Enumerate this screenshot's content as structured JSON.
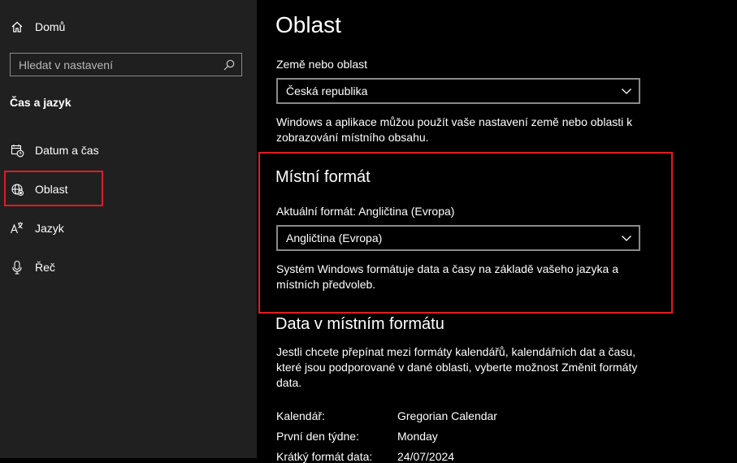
{
  "sidebar": {
    "home_label": "Domů",
    "search_placeholder": "Hledat v nastavení",
    "section_title": "Čas a jazyk",
    "items": [
      {
        "label": "Datum a čas",
        "icon": "calendar-clock-icon"
      },
      {
        "label": "Oblast",
        "icon": "globe-region-icon"
      },
      {
        "label": "Jazyk",
        "icon": "language-icon"
      },
      {
        "label": "Řeč",
        "icon": "microphone-icon"
      }
    ]
  },
  "main": {
    "title": "Oblast",
    "country": {
      "label": "Země nebo oblast",
      "value": "Česká republika",
      "description": "Windows a aplikace můžou použít vaše nastavení země nebo oblasti k zobrazování místního obsahu."
    },
    "regional_format": {
      "heading": "Místní formát",
      "current": "Aktuální formát: Angličtina (Evropa)",
      "value": "Angličtina (Evropa)",
      "description": "Systém Windows formátuje data a časy na základě vašeho jazyka a místních předvoleb."
    },
    "format_data": {
      "heading": "Data v místním formátu",
      "description": "Jestli chcete přepínat mezi formáty kalendářů, kalendářních dat a času, které jsou podporované v dané oblasti, vyberte možnost Změnit formáty data.",
      "rows": [
        {
          "key": "Kalendář:",
          "value": "Gregorian Calendar"
        },
        {
          "key": "První den týdne:",
          "value": "Monday"
        },
        {
          "key": "Krátký formát data:",
          "value": "24/07/2024"
        }
      ]
    }
  },
  "colors": {
    "highlight": "#e01b24",
    "sidebar_bg": "#202020",
    "main_bg": "#000000"
  }
}
